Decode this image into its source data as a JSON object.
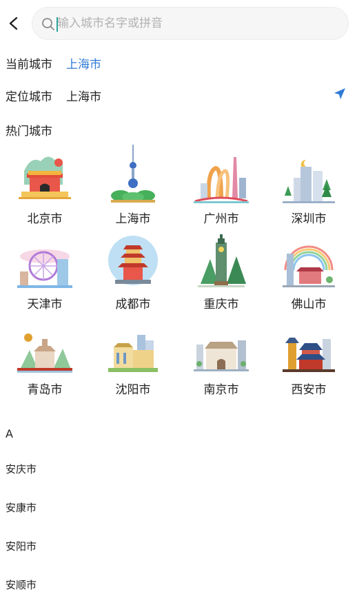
{
  "search": {
    "placeholder": "输入城市名字或拼音"
  },
  "current": {
    "label": "当前城市",
    "value": "上海市"
  },
  "located": {
    "label": "定位城市",
    "value": "上海市"
  },
  "hot": {
    "title": "热门城市",
    "cities": [
      "北京市",
      "上海市",
      "广州市",
      "深圳市",
      "天津市",
      "成都市",
      "重庆市",
      "佛山市",
      "青岛市",
      "沈阳市",
      "南京市",
      "西安市"
    ]
  },
  "alpha_section": {
    "letter": "A",
    "items": [
      "安庆市",
      "安康市",
      "安阳市",
      "安顺市"
    ]
  },
  "colors": {
    "accent": "#2e7ad6",
    "caret": "#29a39a"
  }
}
